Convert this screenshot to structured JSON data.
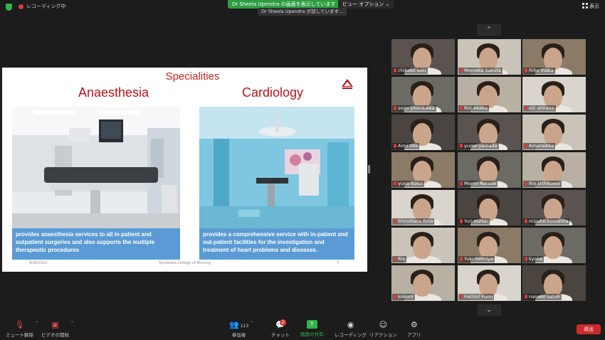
{
  "top_bar": {
    "recording_text": "レコーディング中",
    "share_banner": "Dr Sheela Upendra の画面を表示しています",
    "view_options": "ビュー オプション ⌄",
    "speaking_indicator": "Dr Sheela Upendra が話しています...",
    "view_label": "表示"
  },
  "slide": {
    "title": "Specialities",
    "left": {
      "heading": "Anaesthesia",
      "caption": "provides anaesthesia services to all in patient and outpatient surgeries and  also supports the multiple therapeutic  procedures"
    },
    "right": {
      "heading": "Cardiology",
      "caption": "provides a comprehensive service with in-patient and out-patient facilities for the investigation and treatment of heart problems and diseases."
    },
    "footer_date": "4/26/2022",
    "footer_center": "Symbiosis College of Nursing",
    "footer_page": "7",
    "logo_colors": [
      "#c0101a",
      "#ffffff"
    ]
  },
  "gallery": {
    "up_arrow": "⌃",
    "down_arrow": "⌄",
    "participants": [
      {
        "name": "chikako seki",
        "muted": true
      },
      {
        "name": "Momoka Sakuta",
        "muted": true
      },
      {
        "name": "Riho Inaba",
        "muted": true
      },
      {
        "name": "sogo yoshikawa",
        "muted": true
      },
      {
        "name": "Riri Akaba",
        "muted": true
      },
      {
        "name": "eiji shirano",
        "muted": true
      },
      {
        "name": "Aimi Ote",
        "muted": true
      },
      {
        "name": "yume  yamada",
        "muted": true
      },
      {
        "name": "AmaneAbe",
        "muted": true
      },
      {
        "name": "yuna kusui",
        "muted": true
      },
      {
        "name": "Momo Naruse",
        "muted": true
      },
      {
        "name": "Rio Uchikawa",
        "muted": true
      },
      {
        "name": "Shinohara Rina",
        "muted": true
      },
      {
        "name": "Yuri Kuroki",
        "muted": true
      },
      {
        "name": "mizuho kinoshita",
        "muted": true
      },
      {
        "name": "Rio",
        "muted": true
      },
      {
        "name": "Yuki Seimiya",
        "muted": true
      },
      {
        "name": "kyoka",
        "muted": true
      },
      {
        "name": "kokoro",
        "muted": true
      },
      {
        "name": "Hattori Fumi",
        "muted": true
      },
      {
        "name": "nanako satoh",
        "muted": true
      }
    ]
  },
  "toolbar": {
    "unmute": "ミュート解除",
    "start_video": "ビデオの開始",
    "participants_label": "参加者",
    "participants_count": "113",
    "chat": "チャット",
    "chat_badge": "2",
    "share": "画面の共有",
    "record": "レコーディング",
    "reactions": "リアクション",
    "apps": "アプリ",
    "leave": "退出"
  },
  "colors": {
    "accent_green": "#2fb54a",
    "leave_red": "#cc2a2a",
    "slide_red": "#c0101a",
    "caption_blue": "#5b9bd5"
  }
}
